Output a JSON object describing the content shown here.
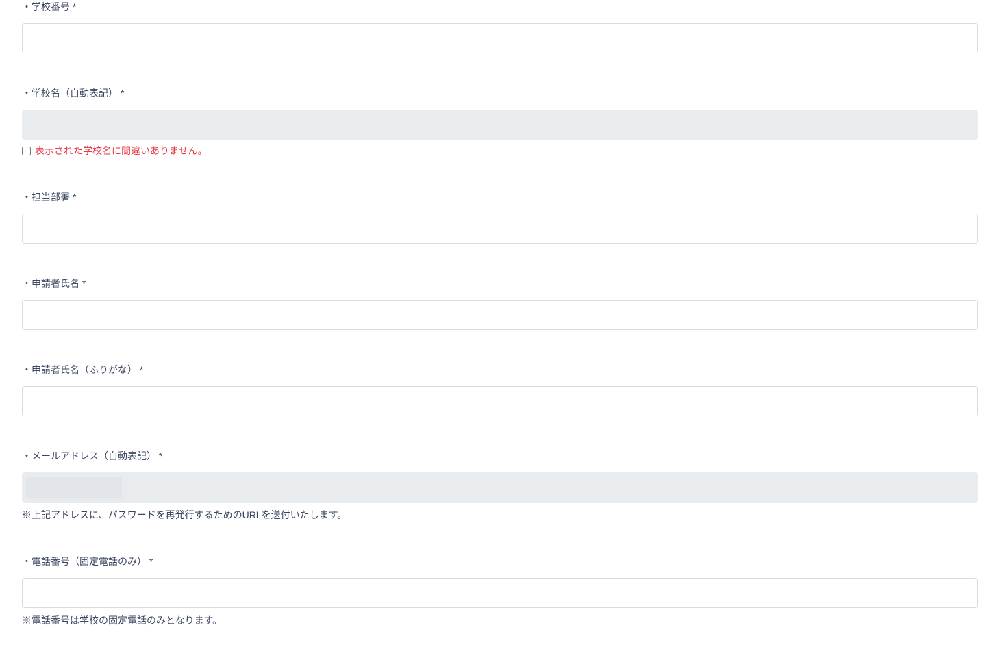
{
  "fields": {
    "schoolNumber": {
      "label": "・学校番号 *"
    },
    "schoolName": {
      "label": "・学校名（自動表記） *",
      "confirmLabel": "表示された学校名に間違いありません。"
    },
    "department": {
      "label": "・担当部署 *"
    },
    "applicantName": {
      "label": "・申請者氏名 *"
    },
    "applicantNameKana": {
      "label": "・申請者氏名（ふりがな） *"
    },
    "email": {
      "label": "・メールアドレス（自動表記） *",
      "note": "※上記アドレスに、パスワードを再発行するためのURLを送付いたします。"
    },
    "phone": {
      "label": "・電話番号（固定電話のみ） *",
      "note": "※電話番号は学校の固定電話のみとなります。"
    }
  }
}
